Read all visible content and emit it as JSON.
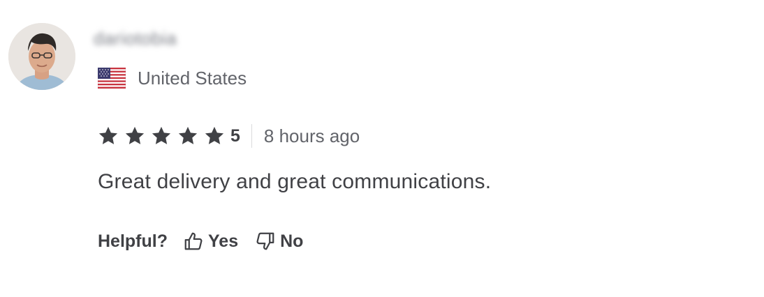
{
  "review": {
    "reviewer": {
      "username": "dariotobia",
      "avatar_icon": "user-avatar-photo",
      "country": "United States",
      "country_flag_icon": "us-flag-icon"
    },
    "rating": {
      "stars": 5,
      "value": "5",
      "star_icon": "star-icon",
      "star_color": "#404145"
    },
    "time_ago": "8 hours ago",
    "text": "Great delivery and great communications.",
    "helpful": {
      "label": "Helpful?",
      "yes_label": "Yes",
      "yes_icon": "thumbs-up-icon",
      "no_label": "No",
      "no_icon": "thumbs-down-icon"
    }
  }
}
